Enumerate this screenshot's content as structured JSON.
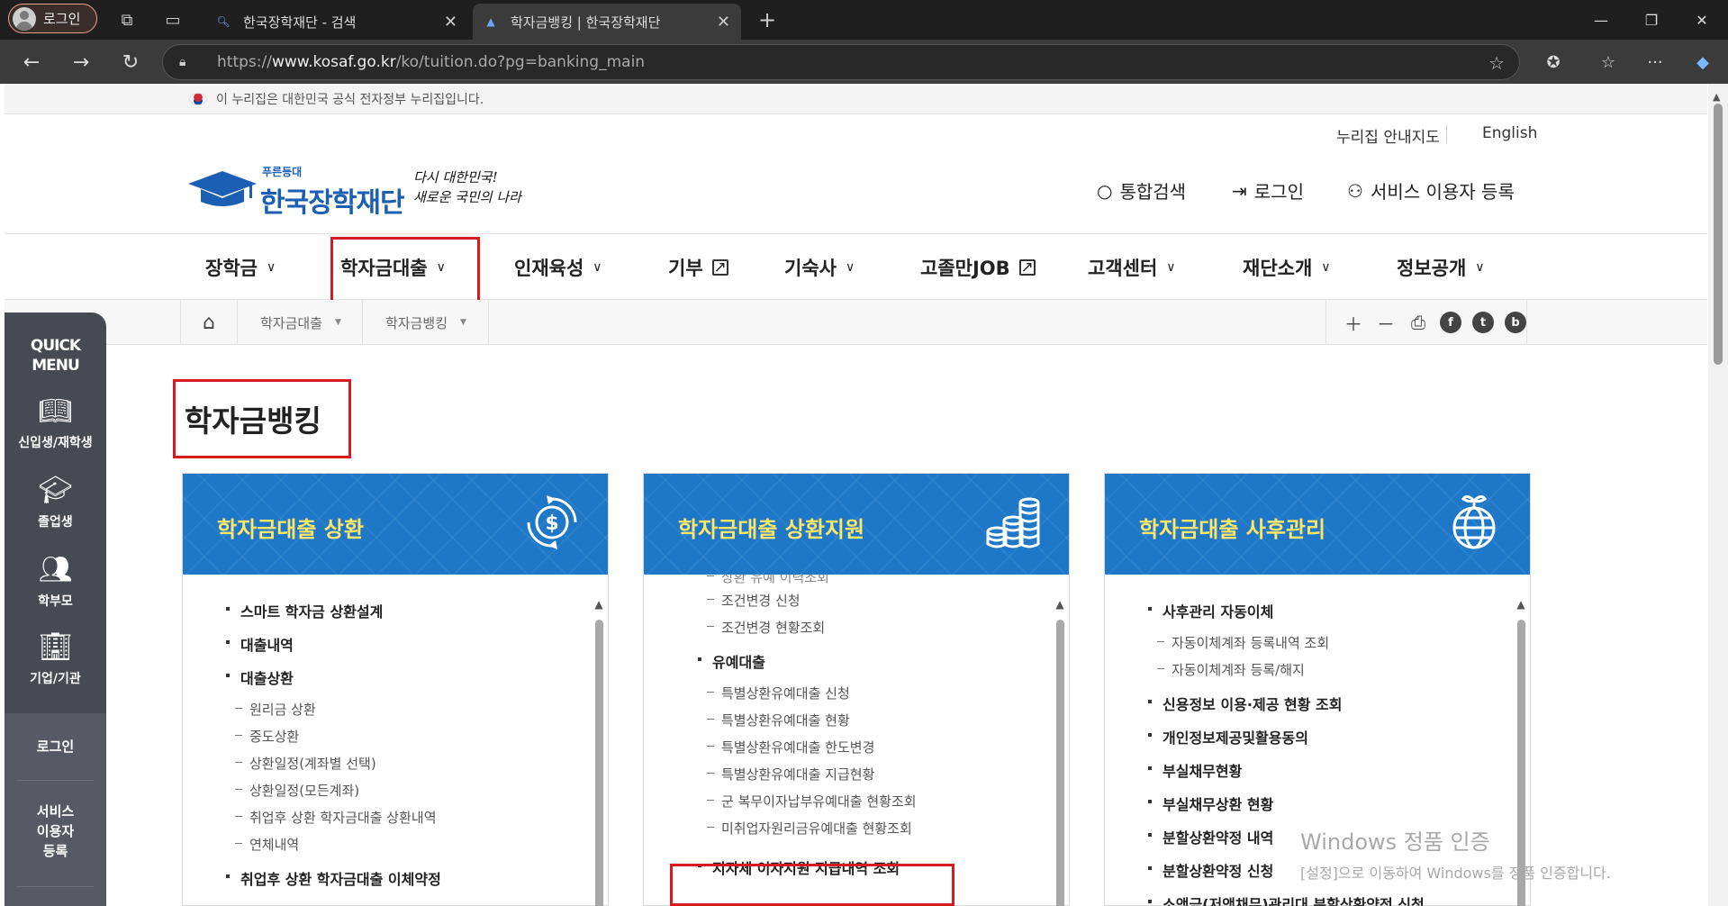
{
  "browser": {
    "profile_label": "로그인",
    "tabs": [
      {
        "title": "한국장학재단 - 검색"
      },
      {
        "title": "학자금뱅킹 | 한국장학재단"
      }
    ],
    "url_prefix": "https://",
    "url_domain": "www.kosaf.go.kr",
    "url_path": "/ko/tuition.do?pg=banking_main"
  },
  "gov_banner": "이 누리집은 대한민국 공식 전자정부 누리집입니다.",
  "utility": {
    "sitemap": "누리집 안내지도",
    "english": "English"
  },
  "logo": {
    "small": "푸른등대",
    "name": "한국장학재단",
    "slogan_1": "다시 대한민국!",
    "slogan_2": "새로운 국민의 나라"
  },
  "header_links": {
    "search": "통합검색",
    "login": "로그인",
    "register": "서비스 이용자 등록"
  },
  "gnb": [
    "장학금",
    "학자금대출",
    "인재육성",
    "기부",
    "기숙사",
    "고졸만JOB",
    "고객센터",
    "재단소개",
    "정보공개"
  ],
  "breadcrumb": [
    "학자금대출",
    "학자금뱅킹"
  ],
  "page_title": "학자금뱅킹",
  "cards": [
    {
      "title": "학자금대출 상환",
      "items": [
        {
          "level": 1,
          "text": "스마트 학자금 상환설계"
        },
        {
          "level": 1,
          "text": "대출내역"
        },
        {
          "level": 1,
          "text": "대출상환"
        },
        {
          "level": 2,
          "text": "원리금 상환"
        },
        {
          "level": 2,
          "text": "중도상환"
        },
        {
          "level": 2,
          "text": "상환일정(계좌별 선택)"
        },
        {
          "level": 2,
          "text": "상환일정(모든계좌)"
        },
        {
          "level": 2,
          "text": "취업후 상환 학자금대출 상환내역"
        },
        {
          "level": 2,
          "text": "연체내역"
        },
        {
          "level": 1,
          "text": "취업후 상환 학자금대출 이체약정"
        }
      ]
    },
    {
      "title": "학자금대출 상환지원",
      "items": [
        {
          "level": 2,
          "text": "상환 유예 이력조회"
        },
        {
          "level": 2,
          "text": "조건변경 신청"
        },
        {
          "level": 2,
          "text": "조건변경 현황조회"
        },
        {
          "level": 1,
          "text": "유예대출"
        },
        {
          "level": 2,
          "text": "특별상환유예대출 신청"
        },
        {
          "level": 2,
          "text": "특별상환유예대출 현황"
        },
        {
          "level": 2,
          "text": "특별상환유예대출 한도변경"
        },
        {
          "level": 2,
          "text": "특별상환유예대출 지급현황"
        },
        {
          "level": 2,
          "text": "군 복무이자납부유예대출 현황조회"
        },
        {
          "level": 2,
          "text": "미취업자원리금유예대출 현황조회"
        },
        {
          "level": 1,
          "text": "지자체 이자지원 지급내역 조회"
        }
      ]
    },
    {
      "title": "학자금대출 사후관리",
      "items": [
        {
          "level": 1,
          "text": "사후관리 자동이체"
        },
        {
          "level": 2,
          "text": "자동이체계좌 등록내역 조회"
        },
        {
          "level": 2,
          "text": "자동이체계좌 등록/해지"
        },
        {
          "level": 1,
          "text": "신용정보 이용·제공 현황 조회"
        },
        {
          "level": 1,
          "text": "개인정보제공및활용동의"
        },
        {
          "level": 1,
          "text": "부실채무현황"
        },
        {
          "level": 1,
          "text": "부실채무상환 현황"
        },
        {
          "level": 1,
          "text": "분할상환약정 내역"
        },
        {
          "level": 1,
          "text": "분할상환약정 신청"
        },
        {
          "level": 1,
          "text": "소액금(저액채무)관리대 분할상환약정 신청"
        }
      ]
    }
  ],
  "quick_menu": {
    "title_1": "QUICK",
    "title_2": "MENU",
    "items": [
      "신입생/재학생",
      "졸업생",
      "학부모",
      "기업/기관"
    ],
    "login": "로그인",
    "service_1": "서비스",
    "service_2": "이용자",
    "service_3": "등록"
  },
  "watermark": {
    "line1": "Windows 정품 인증",
    "line2": "[설정]으로 이동하여 Windows를 정품 인증합니다."
  },
  "colors": {
    "accent_blue": "#1e78c7",
    "card_title": "#ffe566",
    "highlight_red": "#d71920"
  }
}
